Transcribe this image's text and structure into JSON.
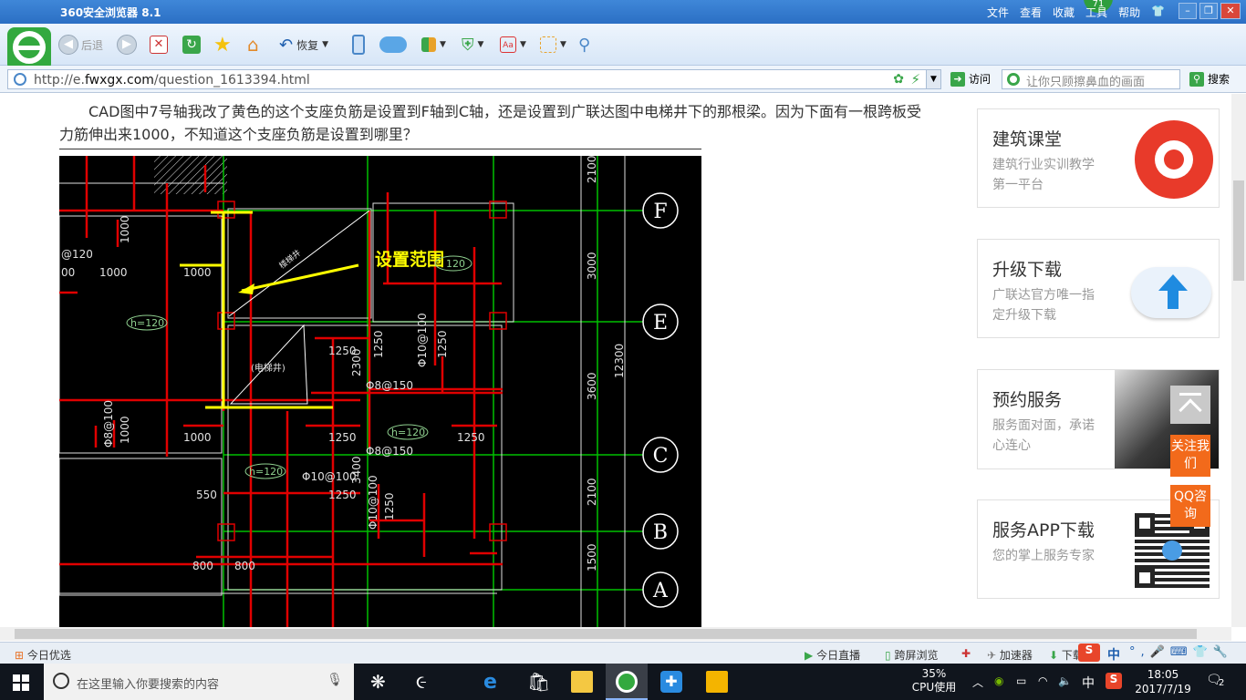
{
  "browser": {
    "title": "360安全浏览器 8.1",
    "menus": [
      "文件",
      "查看",
      "收藏",
      "工具",
      "帮助"
    ],
    "badge": "71",
    "nav": {
      "back_label": "后退",
      "restore_label": "恢复"
    }
  },
  "address_bar": {
    "url_prefix": "http://e.",
    "url_domain": "fwxgx.com",
    "url_path": "/question_1613394.html",
    "go_label": "访问",
    "search_placeholder": "让你只顾擦鼻血的画面",
    "search_label": "搜索"
  },
  "question": {
    "text": "CAD图中7号轴我改了黄色的这个支座负筋是设置到F轴到C轴，还是设置到广联达图中电梯井下的那根梁。因为下面有一根跨板受力筋伸出来1000，不知道这个支座负筋是设置到哪里？"
  },
  "cad": {
    "annotation": "设置范围",
    "axis_labels": [
      "F",
      "E",
      "C",
      "B",
      "A"
    ],
    "dimensions_right": [
      "2100",
      "3000",
      "3600",
      "2100",
      "1500"
    ],
    "total_dimension": "12300",
    "labels": {
      "d1000a": "1000",
      "d1000b": "1000",
      "d1000c": "1000",
      "d1000d": "1000",
      "d1000e": "1000",
      "d1250a": "1250",
      "d1250b": "1250",
      "d1250c": "1250",
      "d1250d": "1250",
      "d1250e": "1250",
      "d1250f": "1250",
      "d1250g": "1250",
      "d2300": "2300",
      "d3400": "3400",
      "d550": "550",
      "d800a": "800",
      "d800b": "800",
      "d120": "@120",
      "d00": "00",
      "h120a": "h=120",
      "h120b": "h=120",
      "h120c": "h=120",
      "h120d": "120",
      "r8150a": "Φ8@150",
      "r8150b": "Φ8@150",
      "r10100a": "Φ10@100",
      "r10100b": "Φ10@100",
      "r10100c": "Φ10@100",
      "r8100": "Φ8@100",
      "elevator": "(电梯井)",
      "shaft": "楼梯井"
    }
  },
  "sidebar": {
    "cards": [
      {
        "title": "建筑课堂",
        "subtitle": "建筑行业实训教学第一平台"
      },
      {
        "title": "升级下载",
        "subtitle": "广联达官方唯一指定升级下载"
      },
      {
        "title": "预约服务",
        "subtitle": "服务面对面，承诺心连心"
      },
      {
        "title": "服务APP下载",
        "subtitle": "您的掌上服务专家"
      }
    ],
    "follow_label": "关注我们",
    "qq_label": "QQ咨询"
  },
  "statusbar": {
    "left": "今日优选",
    "live": "今日直播",
    "cross_screen": "跨屏浏览",
    "accelerator": "加速器",
    "download": "下载",
    "ime": "中"
  },
  "taskbar": {
    "search_placeholder": "在这里输入你要搜索的内容",
    "cpu_percent": "35%",
    "cpu_label": "CPU使用",
    "ime": "中",
    "time": "18:05",
    "date": "2017/7/19",
    "notifications": "2"
  },
  "colors": {
    "titlebar": "#2b6fc4",
    "accent_orange": "#f26a1b",
    "logo_green": "#33a93f",
    "cad_red": "#e00000",
    "cad_yellow": "#ffff00",
    "cad_green": "#00c000"
  }
}
